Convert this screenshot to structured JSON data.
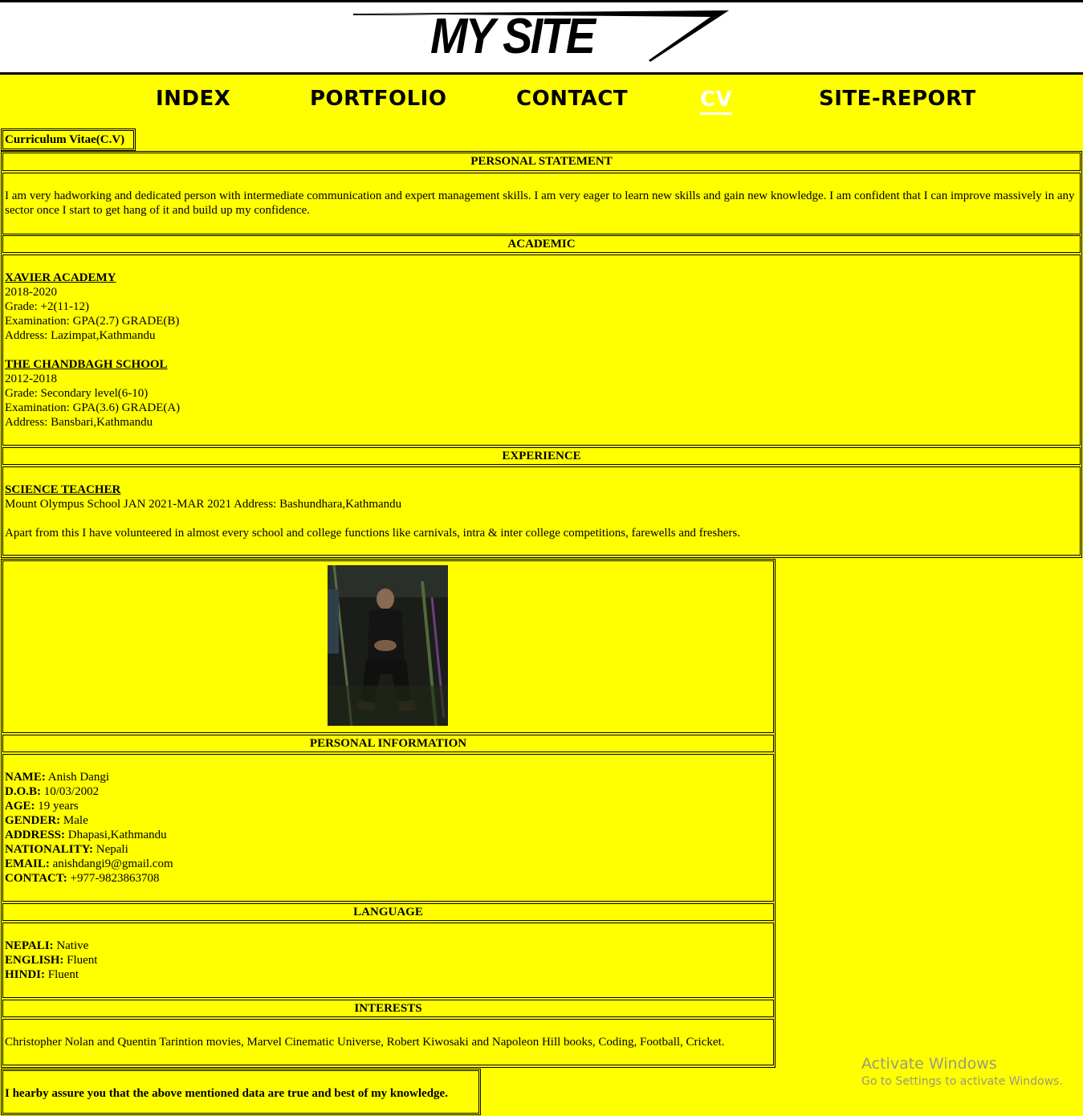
{
  "site": {
    "logo_text": "MY SITE"
  },
  "nav": {
    "items": [
      {
        "label": "INDEX"
      },
      {
        "label": "PORTFOLIO"
      },
      {
        "label": "CONTACT"
      },
      {
        "label": "CV"
      },
      {
        "label": "SITE-REPORT"
      }
    ],
    "active": "CV"
  },
  "cv": {
    "title": "Curriculum Vitae(C.V)",
    "personal_statement": {
      "heading": "PERSONAL STATEMENT",
      "text": "I am very hadworking and dedicated person with intermediate communication and expert management skills. I am very eager to learn new skills and gain new knowledge. I am confident that I can improve massively in any sector once I start to get hang of it and build up my confidence."
    },
    "academic": {
      "heading": "ACADEMIC",
      "schools": [
        {
          "name": "XAVIER ACADEMY",
          "years": "2018-2020",
          "grade": "Grade: +2(11-12)",
          "exam": "Examination: GPA(2.7) GRADE(B)",
          "address": "Address: Lazimpat,Kathmandu"
        },
        {
          "name": "THE CHANDBAGH SCHOOL",
          "years": "2012-2018",
          "grade": "Grade: Secondary level(6-10)",
          "exam": "Examination: GPA(3.6) GRADE(A)",
          "address": "Address: Bansbari,Kathmandu"
        }
      ]
    },
    "experience": {
      "heading": "EXPERIENCE",
      "role": "SCIENCE TEACHER",
      "detail": "Mount Olympus School JAN 2021-MAR 2021 Address: Bashundhara,Kathmandu",
      "extra": "Apart from this I have volunteered in almost every school and college functions like carnivals, intra & inter college competitions, farewells and freshers."
    },
    "personal_information": {
      "heading": "PERSONAL INFORMATION",
      "rows": [
        {
          "label": "NAME:",
          "value": " Anish Dangi"
        },
        {
          "label": "D.O.B:",
          "value": " 10/03/2002"
        },
        {
          "label": "AGE:",
          "value": " 19 years"
        },
        {
          "label": "GENDER:",
          "value": " Male"
        },
        {
          "label": "ADDRESS:",
          "value": " Dhapasi,Kathmandu"
        },
        {
          "label": "NATIONALITY:",
          "value": " Nepali"
        },
        {
          "label": "EMAIL:",
          "value": " anishdangi9@gmail.com"
        },
        {
          "label": "CONTACT:",
          "value": " +977-9823863708"
        }
      ]
    },
    "language": {
      "heading": "LANGUAGE",
      "rows": [
        {
          "label": "NEPALI:",
          "value": " Native"
        },
        {
          "label": "ENGLISH:",
          "value": " Fluent"
        },
        {
          "label": "HINDI:",
          "value": " Fluent"
        }
      ]
    },
    "interests": {
      "heading": "INTERESTS",
      "text": "Christopher Nolan and Quentin Tarintion movies, Marvel Cinematic Universe, Robert Kiwosaki and Napoleon Hill books, Coding, Football, Cricket."
    },
    "declaration": "I hearby assure you that the above mentioned data are true and best of my knowledge."
  },
  "watermark": {
    "title": "Activate Windows",
    "subtitle": "Go to Settings to activate Windows."
  },
  "colors": {
    "background": "#ffff00",
    "header_bg": "#ffffff",
    "active_nav": "#ffffff"
  }
}
